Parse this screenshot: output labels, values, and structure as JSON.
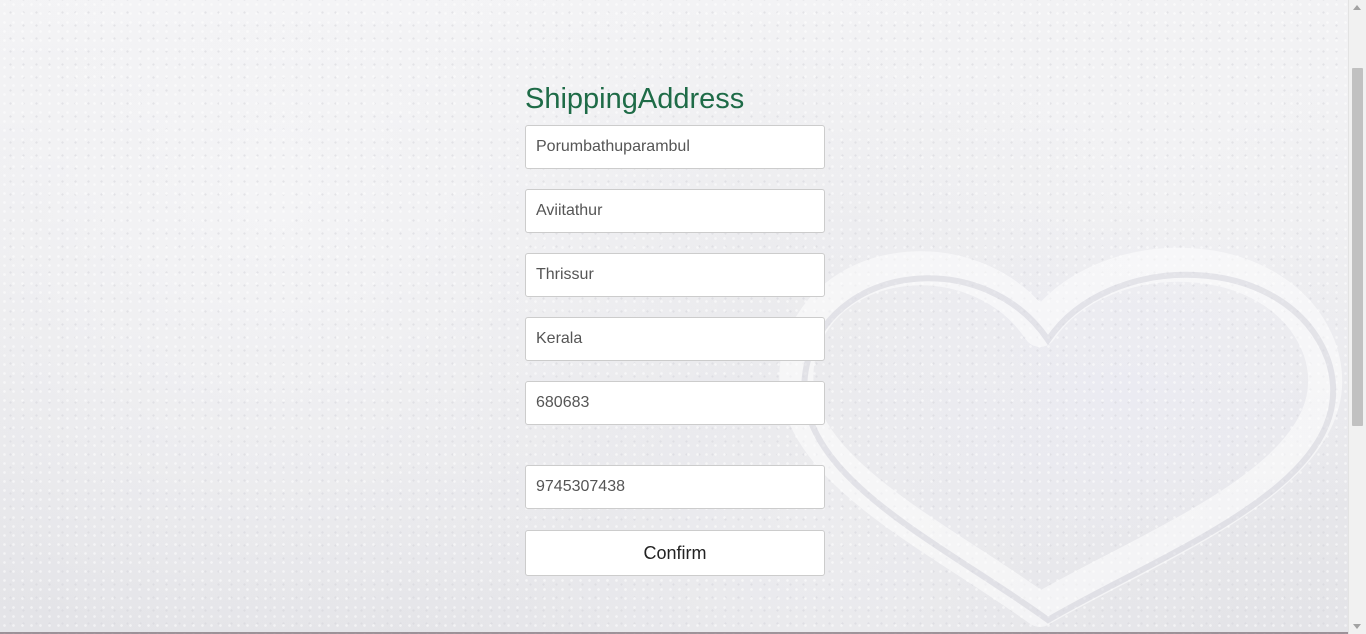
{
  "page": {
    "title": "ShippingAddress"
  },
  "form": {
    "address_line1": "Porumbathuparambul",
    "address_line2": "Aviitathur",
    "city": "Thrissur",
    "state": "Kerala",
    "pincode": "680683",
    "phone": "9745307438",
    "confirm_label": "Confirm"
  },
  "colors": {
    "title": "#1e6b47",
    "field_border": "#cccccc",
    "field_text": "#555555"
  }
}
